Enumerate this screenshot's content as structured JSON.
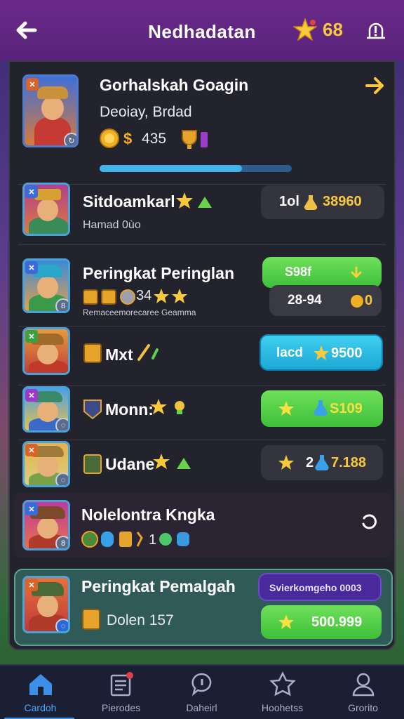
{
  "header": {
    "title": "Nedhadatan",
    "stars": "68"
  },
  "top_card": {
    "name": "Gorhalskah Goagin",
    "subtitle": "Deoiay, Brdad",
    "coins": "435",
    "progress": 0.74
  },
  "rows": [
    {
      "name": "Sitdoamkarl",
      "small": "Hamad 0ùo",
      "pill_left": "1ol",
      "pill_right": "38960"
    },
    {
      "name": "Peringkat Peringlan",
      "pill1": "S98f",
      "pill2_left": "28-94",
      "pill2_right": "0",
      "icons_text": "34",
      "small": "Remaceemorecaree Geamma"
    },
    {
      "name": "Mxt",
      "pill_left": "lacd",
      "pill_right": "9500"
    },
    {
      "name": "Monn:",
      "pill_right": "S109"
    },
    {
      "name": "Udane",
      "pill_mid": "2",
      "pill_right": "7.188"
    },
    {
      "name": "Nolelontra Kngka",
      "icons_text": "1"
    },
    {
      "name": "Peringkat Pemalgah",
      "subtitle": "Dolen 157",
      "pill_top": "Svierkomgeho 0003",
      "pill_right": "500.999"
    }
  ],
  "bottom_nav": [
    {
      "label": "Cardoh",
      "icon": "home-icon",
      "active": true
    },
    {
      "label": "Pierodes",
      "icon": "list-icon",
      "active": false
    },
    {
      "label": "Daheirl",
      "icon": "chat-icon",
      "active": false
    },
    {
      "label": "Hoohetss",
      "icon": "badge-icon",
      "active": false
    },
    {
      "label": "Grorito",
      "icon": "profile-icon",
      "active": false
    }
  ],
  "colors": {
    "header": "#58237a",
    "panel": "#23232d",
    "accent_green": "#3fbf3a",
    "accent_blue": "#1ca8d4",
    "gold": "#f8c93a"
  }
}
